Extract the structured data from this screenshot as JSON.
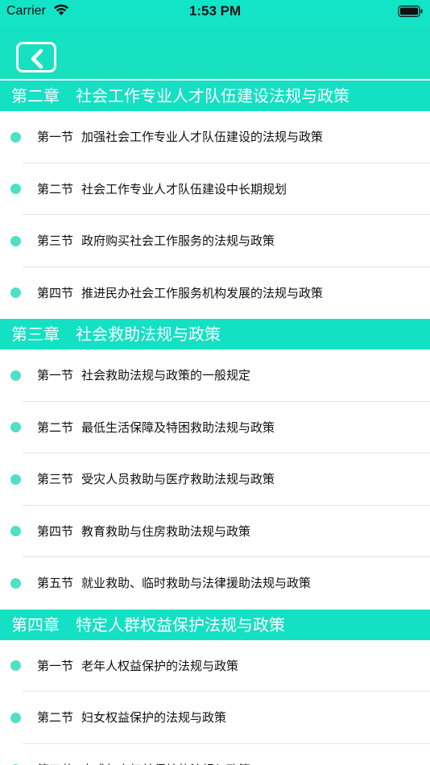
{
  "status_bar": {
    "carrier": "Carrier",
    "time": "1:53 PM"
  },
  "nav": {
    "back_icon": "chevron-left-icon"
  },
  "colors": {
    "header": "#14e0c4",
    "dot": "#4fe0c6"
  },
  "chapters": [
    {
      "number": "第二章",
      "title": "社会工作专业人才队伍建设法规与政策",
      "sections": [
        {
          "number": "第一节",
          "title": "加强社会工作专业人才队伍建设的法规与政策"
        },
        {
          "number": "第二节",
          "title": "社会工作专业人才队伍建设中长期规划"
        },
        {
          "number": "第三节",
          "title": "政府购买社会工作服务的法规与政策"
        },
        {
          "number": "第四节",
          "title": "推进民办社会工作服务机构发展的法规与政策"
        }
      ]
    },
    {
      "number": "第三章",
      "title": "社会救助法规与政策",
      "sections": [
        {
          "number": "第一节",
          "title": "社会救助法规与政策的一般规定"
        },
        {
          "number": "第二节",
          "title": "最低生活保障及特困救助法规与政策"
        },
        {
          "number": "第三节",
          "title": "受灾人员救助与医疗救助法规与政策"
        },
        {
          "number": "第四节",
          "title": "教育救助与住房救助法规与政策"
        },
        {
          "number": "第五节",
          "title": "就业救助、临时救助与法律援助法规与政策"
        }
      ]
    },
    {
      "number": "第四章",
      "title": "特定人群权益保护法规与政策",
      "sections": [
        {
          "number": "第一节",
          "title": "老年人权益保护的法规与政策"
        },
        {
          "number": "第二节",
          "title": "妇女权益保护的法规与政策"
        },
        {
          "number": "第三节",
          "title": "未成年人权益保护的法规与政策"
        }
      ]
    }
  ]
}
